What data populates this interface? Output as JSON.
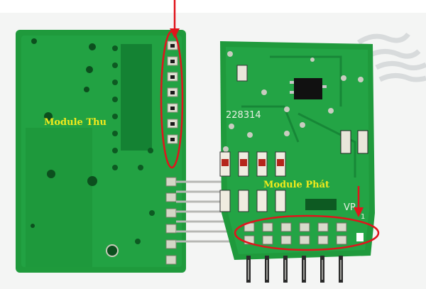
{
  "labels": {
    "receiver": "Module Thu",
    "transmitter": "Module Phát"
  },
  "silkscreen": {
    "chip_code": "228314",
    "vr_mark": "VR",
    "vr_number": "1"
  },
  "colors": {
    "pcb_green": "#1f9a3c",
    "pcb_dark": "#0f6e2a",
    "highlight_red": "#e0141c",
    "label_yellow": "#f2ea1c"
  }
}
